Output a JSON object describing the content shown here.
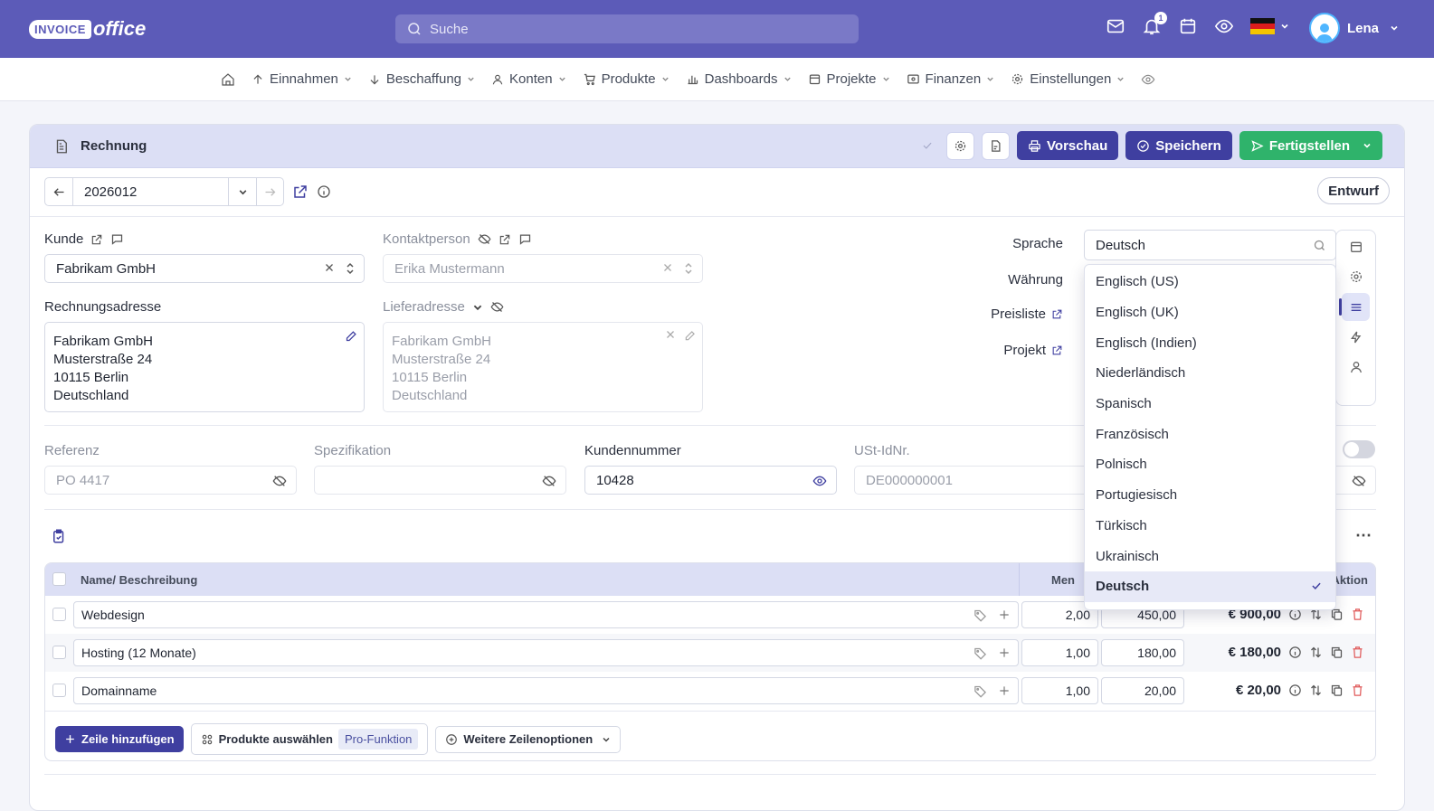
{
  "app": {
    "logo_main": "INVOICE",
    "logo_sub": "office"
  },
  "search": {
    "placeholder": "Suche"
  },
  "notifications": {
    "count": "1"
  },
  "user": {
    "name": "Lena"
  },
  "nav": [
    {
      "label": "Einnahmen"
    },
    {
      "label": "Beschaffung"
    },
    {
      "label": "Konten"
    },
    {
      "label": "Produkte"
    },
    {
      "label": "Dashboards"
    },
    {
      "label": "Projekte"
    },
    {
      "label": "Finanzen"
    },
    {
      "label": "Einstellungen"
    }
  ],
  "doc": {
    "title": "Rechnung",
    "preview": "Vorschau",
    "save": "Speichern",
    "finish": "Fertigstellen",
    "number": "2026012",
    "status": "Entwurf"
  },
  "customer": {
    "label": "Kunde",
    "value": "Fabrikam GmbH",
    "contact_label": "Kontaktperson",
    "contact_value": "Erika Mustermann",
    "billing_label": "Rechnungsadresse",
    "billing": [
      "Fabrikam GmbH",
      "Musterstraße 24",
      "10115 Berlin",
      "Deutschland"
    ],
    "delivery_label": "Lieferadresse",
    "delivery": [
      "Fabrikam GmbH",
      "Musterstraße 24",
      "10115 Berlin",
      "Deutschland"
    ]
  },
  "settings": {
    "language_label": "Sprache",
    "language_value": "Deutsch",
    "currency_label": "Währung",
    "pricelist_label": "Preisliste",
    "project_label": "Projekt"
  },
  "language_options": [
    "Englisch (US)",
    "Englisch (UK)",
    "Englisch (Indien)",
    "Niederländisch",
    "Spanisch",
    "Französisch",
    "Polnisch",
    "Portugiesisch",
    "Türkisch",
    "Ukrainisch",
    "Deutsch"
  ],
  "refs": {
    "referenz_label": "Referenz",
    "referenz_value": "PO 4417",
    "spez_label": "Spezifikation",
    "kundennr_label": "Kundennummer",
    "kundennr_value": "10428",
    "ust_label": "USt-IdNr.",
    "ust_value": "DE000000001"
  },
  "table": {
    "col_name": "Name/ Beschreibung",
    "col_qty": "Men",
    "col_action": "Aktion",
    "rows": [
      {
        "name": "Webdesign",
        "qty": "2,00",
        "price": "450,00",
        "total": "€ 900,00"
      },
      {
        "name": "Hosting (12 Monate)",
        "qty": "1,00",
        "price": "180,00",
        "total": "€ 180,00"
      },
      {
        "name": "Domainname",
        "qty": "1,00",
        "price": "20,00",
        "total": "€ 20,00"
      }
    ],
    "add_row": "Zeile hinzufügen",
    "select_products": "Produkte auswählen",
    "pro_badge": "Pro-Funktion",
    "more_options": "Weitere Zeilenoptionen"
  },
  "colors": {
    "brand": "#5c5bb8",
    "primary": "#3f3fa0",
    "success": "#2fb36b",
    "danger": "#e05a5a"
  }
}
